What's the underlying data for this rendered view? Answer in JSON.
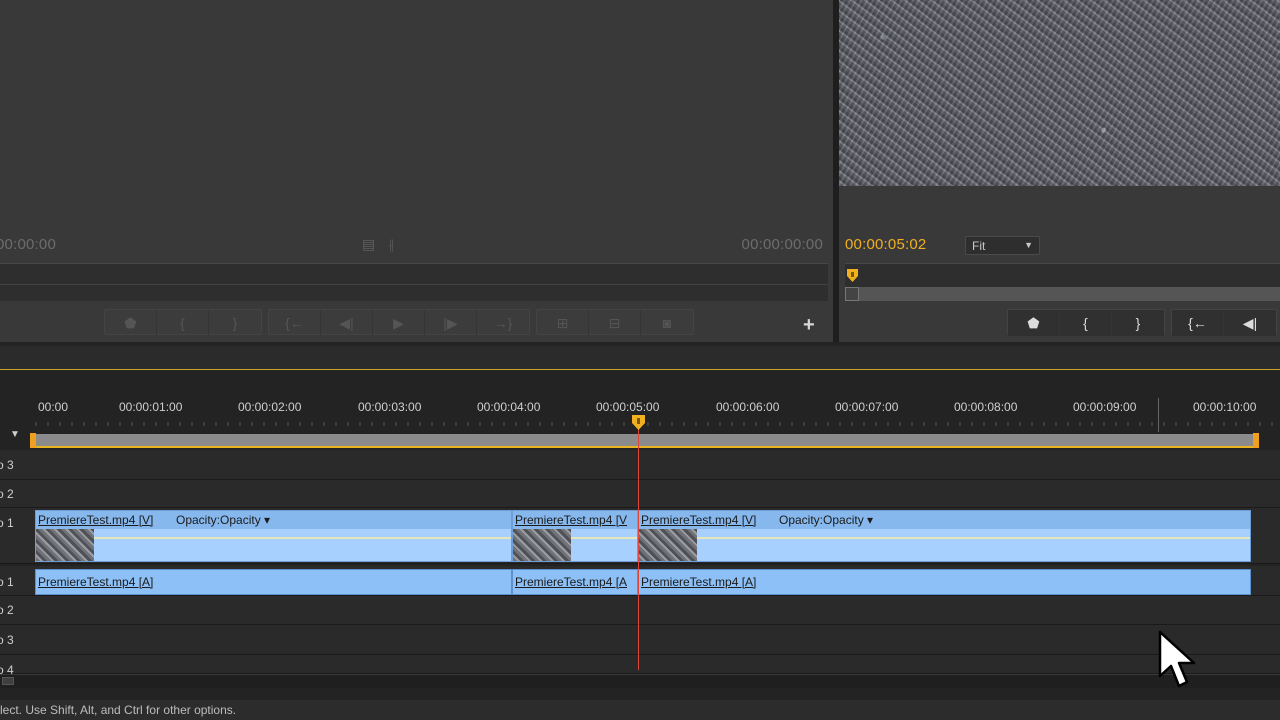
{
  "source_monitor": {
    "time_left": "00:00:00",
    "time_right": "00:00:00:00",
    "mid_icons": [
      "film-icon",
      "waveform-icon"
    ],
    "transport_groups": [
      [
        "marker-icon",
        "mark-in-icon",
        "mark-out-icon"
      ],
      [
        "go-to-in-icon",
        "step-back-icon",
        "play-icon",
        "step-forward-icon",
        "go-to-out-icon"
      ],
      [
        "insert-icon",
        "overwrite-icon",
        "export-frame-icon"
      ]
    ],
    "add_button": "+"
  },
  "program_monitor": {
    "timecode": "00:00:05:02",
    "zoom_select": "Fit",
    "transport": [
      "marker-icon",
      "mark-in-icon",
      "mark-out-icon",
      "go-to-in-icon",
      "step-back-icon"
    ]
  },
  "timeline": {
    "ruler_labels": [
      "00:00",
      "00:00:01:00",
      "00:00:02:00",
      "00:00:03:00",
      "00:00:04:00",
      "00:00:05:00",
      "00:00:06:00",
      "00:00:07:00",
      "00:00:08:00",
      "00:00:09:00",
      "00:00:10:00"
    ],
    "tracks": {
      "v3": "o 3",
      "v2": "o 2",
      "v1": "o 1",
      "a1": "o 1",
      "a2": "o 2",
      "a3": "o 3",
      "a4": "o 4"
    },
    "video_clips": [
      {
        "name": "PremiereTest.mp4 [V]",
        "fx": "Opacity:Opacity ▾"
      },
      {
        "name": "PremiereTest.mp4 [V",
        "fx": ""
      },
      {
        "name": "PremiereTest.mp4 [V]",
        "fx": "Opacity:Opacity ▾"
      }
    ],
    "audio_clips": [
      {
        "name": "PremiereTest.mp4 [A]"
      },
      {
        "name": "PremiereTest.mp4 [A"
      },
      {
        "name": "PremiereTest.mp4 [A]"
      }
    ]
  },
  "status_bar": {
    "text": "lect. Use Shift, Alt, and Ctrl for other options."
  },
  "colors": {
    "accent_timecode": "#f0b020",
    "clip_video": "#a8d0ff",
    "clip_audio": "#8cc0f6",
    "playhead": "#e0453a"
  }
}
